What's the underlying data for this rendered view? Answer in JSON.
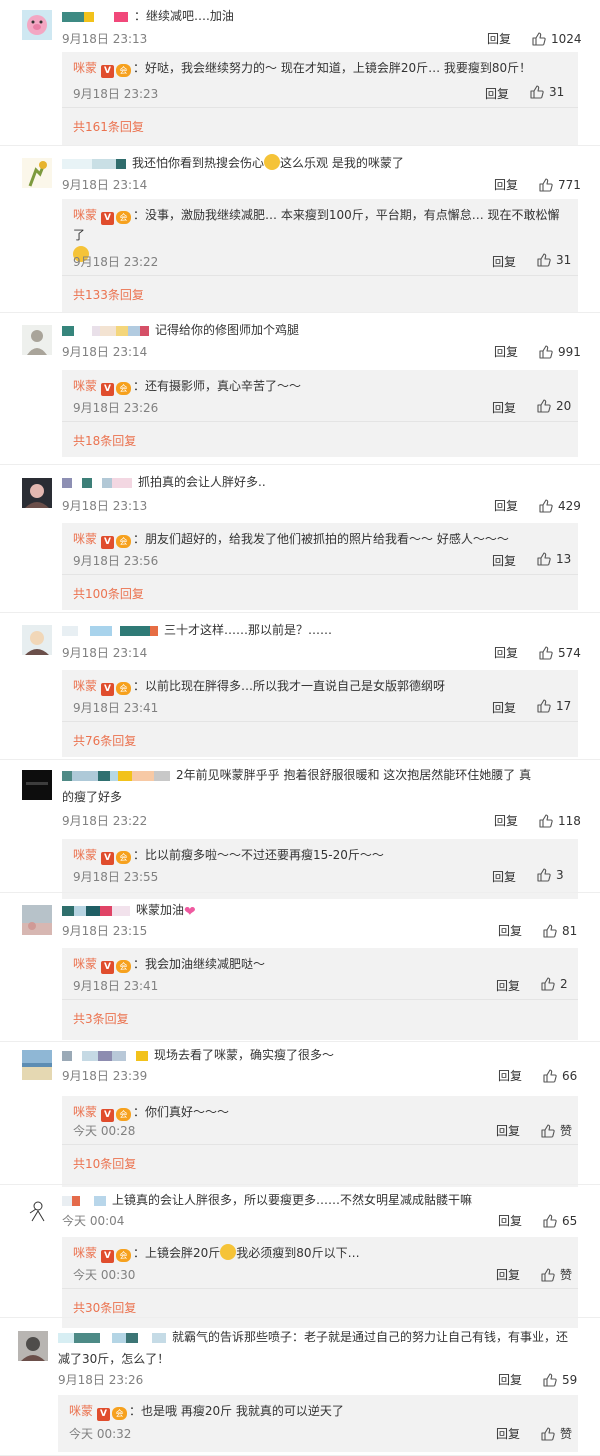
{
  "ui": {
    "reply_label": "回复",
    "like_icon": "thumb-up-icon",
    "verified_badge": "V",
    "level_badge": "会"
  },
  "comments": [
    {
      "text": "：继续减吧….加油",
      "time": "9月18日 23:13",
      "likes": "1024",
      "censor_colors": [
        "#3e8a83",
        "#f2c21b",
        "#ffffff",
        "#f1487a"
      ],
      "reply": {
        "author": "咪蒙",
        "text": "：好哒，我会继续努力的～ 现在才知道，上镜会胖20斤… 我要瘦到80斤！",
        "time": "9月18日 23:23",
        "likes": "31"
      },
      "total": "共161条回复"
    },
    {
      "text": "我还怕你看到热搜会伤心",
      "text_after_emoji": "这么乐观 是我的咪蒙了",
      "time": "9月18日 23:14",
      "likes": "771",
      "censor_colors": [
        "#e8f3f6",
        "#c9dfe5",
        "#2f6c6c"
      ],
      "reply": {
        "author": "咪蒙",
        "text": "：没事，激励我继续减肥… 本来瘦到100斤，平台期，有点懈怠… 现在不敢松懈了",
        "time": "9月18日 23:22",
        "likes": "31"
      },
      "total": "共133条回复"
    },
    {
      "text": "记得给你的修图师加个鸡腿",
      "time": "9月18日 23:14",
      "likes": "991",
      "censor_colors": [
        "#36857c",
        "#ffffff",
        "#e9e0e9",
        "#f3e3d2",
        "#f4d67b",
        "#b2cbe0",
        "#d55067"
      ],
      "reply": {
        "author": "咪蒙",
        "text": "：还有摄影师，真心辛苦了～～",
        "time": "9月18日 23:26",
        "likes": "20"
      },
      "total": "共18条回复"
    },
    {
      "text": "抓拍真的会让人胖好多..",
      "time": "9月18日 23:13",
      "likes": "429",
      "censor_colors": [
        "#8d8fb3",
        "#ffffff",
        "#3d7f78",
        "#ffffff",
        "#b2c8d6",
        "#f3d7e2"
      ],
      "reply": {
        "author": "咪蒙",
        "text": "：朋友们超好的，给我发了他们被抓拍的照片给我看～～ 好感人～～～",
        "time": "9月18日 23:56",
        "likes": "13"
      },
      "total": "共100条回复"
    },
    {
      "text": "三十才这样……那以前是？……",
      "time": "9月18日 23:14",
      "likes": "574",
      "censor_colors": [
        "#e8eff3",
        "#ffffff",
        "#a8d3ec",
        "#ffffff",
        "#2f7a76",
        "#e66d44"
      ],
      "reply": {
        "author": "咪蒙",
        "text": "：以前比现在胖得多…所以我才一直说自己是女版郭德纲呀",
        "time": "9月18日 23:41",
        "likes": "17"
      },
      "total": "共76条回复"
    },
    {
      "text": "2年前见咪蒙胖乎乎 抱着很舒服很暖和 这次抱居然能环住她腰了 真",
      "text_line2": "的瘦了好多",
      "time": "9月18日 23:22",
      "likes": "118",
      "censor_colors": [
        "#4f8a86",
        "#aec9d8",
        "#2f7070",
        "#b6d8e6",
        "#f2c21b",
        "#f7c9a5",
        "#c8c8c8"
      ],
      "reply": {
        "author": "咪蒙",
        "text": "：比以前瘦多啦～～不过还要再瘦15-20斤～～",
        "time": "9月18日 23:55",
        "likes": "3"
      },
      "total": ""
    },
    {
      "text": "咪蒙加油",
      "time": "9月18日 23:15",
      "likes": "81",
      "censor_colors": [
        "#2f6f6c",
        "#b7d4e2",
        "#1f5e64",
        "#e04466",
        "#f2e2ec"
      ],
      "reply": {
        "author": "咪蒙",
        "text": "：我会加油继续减肥哒～",
        "time": "9月18日 23:41",
        "likes": "2"
      },
      "total": "共3条回复"
    },
    {
      "text": "现场去看了咪蒙，确实瘦了很多～",
      "time": "9月18日 23:39",
      "likes": "66",
      "censor_colors": [
        "#9aa9b6",
        "#ffffff",
        "#c5d9e4",
        "#8d8cb0",
        "#b8c8d8",
        "#ffffff",
        "#f2c21b"
      ],
      "reply": {
        "author": "咪蒙",
        "text": "：你们真好～～～",
        "time": "今天 00:28",
        "likes": "赞"
      },
      "total": "共10条回复"
    },
    {
      "text": "上镜真的会让人胖很多，所以要瘦更多……不然女明星减成骷髅干嘛",
      "time": "今天 00:04",
      "likes": "65",
      "censor_colors": [
        "#e9eef2",
        "#e46a4a",
        "#ffffff",
        "#b8d6ea"
      ],
      "reply": {
        "author": "咪蒙",
        "text": "：上镜会胖20斤",
        "text_after_emoji": "我必须瘦到80斤以下…",
        "time": "今天 00:30",
        "likes": "赞"
      },
      "total": "共30条回复"
    },
    {
      "text": "就霸气的告诉那些喷子：老子就是通过自己的努力让自己有钱，有事业，还",
      "text_line2": "减了30斤，怎么了！",
      "time": "9月18日 23:26",
      "likes": "59",
      "censor_colors": [
        "#d7eef3",
        "#4d8a86",
        "#ffffff",
        "#b4d5e5",
        "#3c7575",
        "#ffffff",
        "#c5dbe6"
      ],
      "reply": {
        "author": "咪蒙",
        "text": "：也是哦 再瘦20斤 我就真的可以逆天了",
        "time": "今天 00:32",
        "likes": "赞"
      },
      "total": ""
    }
  ]
}
